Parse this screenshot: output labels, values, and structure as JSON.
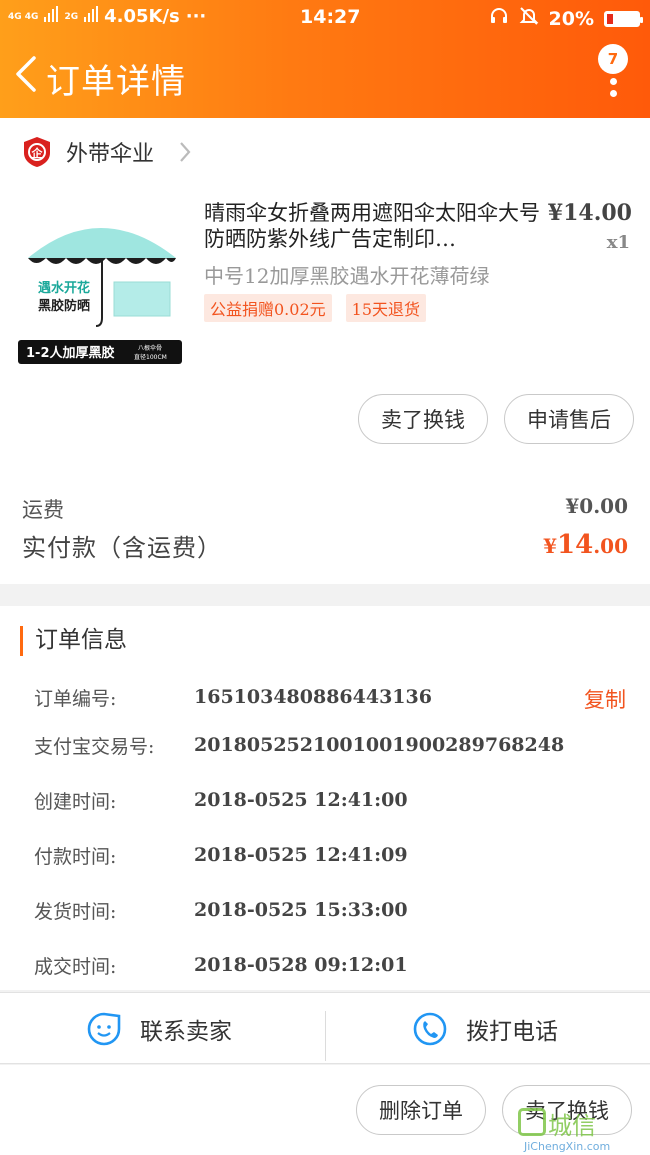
{
  "status_bar": {
    "network": "4G 4G",
    "network2": "2G",
    "speed": "4.05K/s",
    "dots": "···",
    "time": "14:27",
    "battery": "20%",
    "battery_level": 0.2
  },
  "header": {
    "title": "订单详情",
    "badge": "7"
  },
  "shop": {
    "name": "外带伞业"
  },
  "product": {
    "title": "晴雨伞女折叠两用遮阳伞太阳伞大号防晒防紫外线广告定制印…",
    "price": "¥14.00",
    "qty": "x1",
    "spec": "中号12加厚黑胶遇水开花薄荷绿",
    "tags": [
      "公益捐赠0.02元",
      "15天退货"
    ],
    "image_text": {
      "line1": "遇水开花",
      "line2": "黑胶防晒",
      "banner": "1-2人加厚黑胶",
      "banner_small1": "八根伞骨",
      "banner_small2": "直径100CM"
    }
  },
  "actions_top": {
    "sell": "卖了换钱",
    "after_sale": "申请售后"
  },
  "fees": {
    "shipping_label": "运费",
    "shipping_value": "¥0.00",
    "paid_label": "实付款（含运费）",
    "paid_currency": "¥",
    "paid_int": "14",
    "paid_dec": ".00"
  },
  "order_info": {
    "section_title": "订单信息",
    "copy": "复制",
    "rows": [
      {
        "key": "订单编号:",
        "value": "165103480886443136"
      },
      {
        "key": "支付宝交易号:",
        "value": "2018052521001001900289768248"
      },
      {
        "key": "创建时间:",
        "value": "2018-0525 12:41:00"
      },
      {
        "key": "付款时间:",
        "value": "2018-0525 12:41:09"
      },
      {
        "key": "发货时间:",
        "value": "2018-0525 15:33:00"
      },
      {
        "key": "成交时间:",
        "value": "2018-0528 09:12:01"
      }
    ]
  },
  "contact": {
    "seller": "联系卖家",
    "call": "拨打电话"
  },
  "actions_bottom": {
    "delete": "删除订单",
    "sell": "卖了换钱"
  },
  "watermark": {
    "text": "城信",
    "site": "JiChengXin.com"
  },
  "colors": {
    "accent": "#ff6a10",
    "price_red": "#f2541f",
    "icon_blue": "#2196f3"
  }
}
